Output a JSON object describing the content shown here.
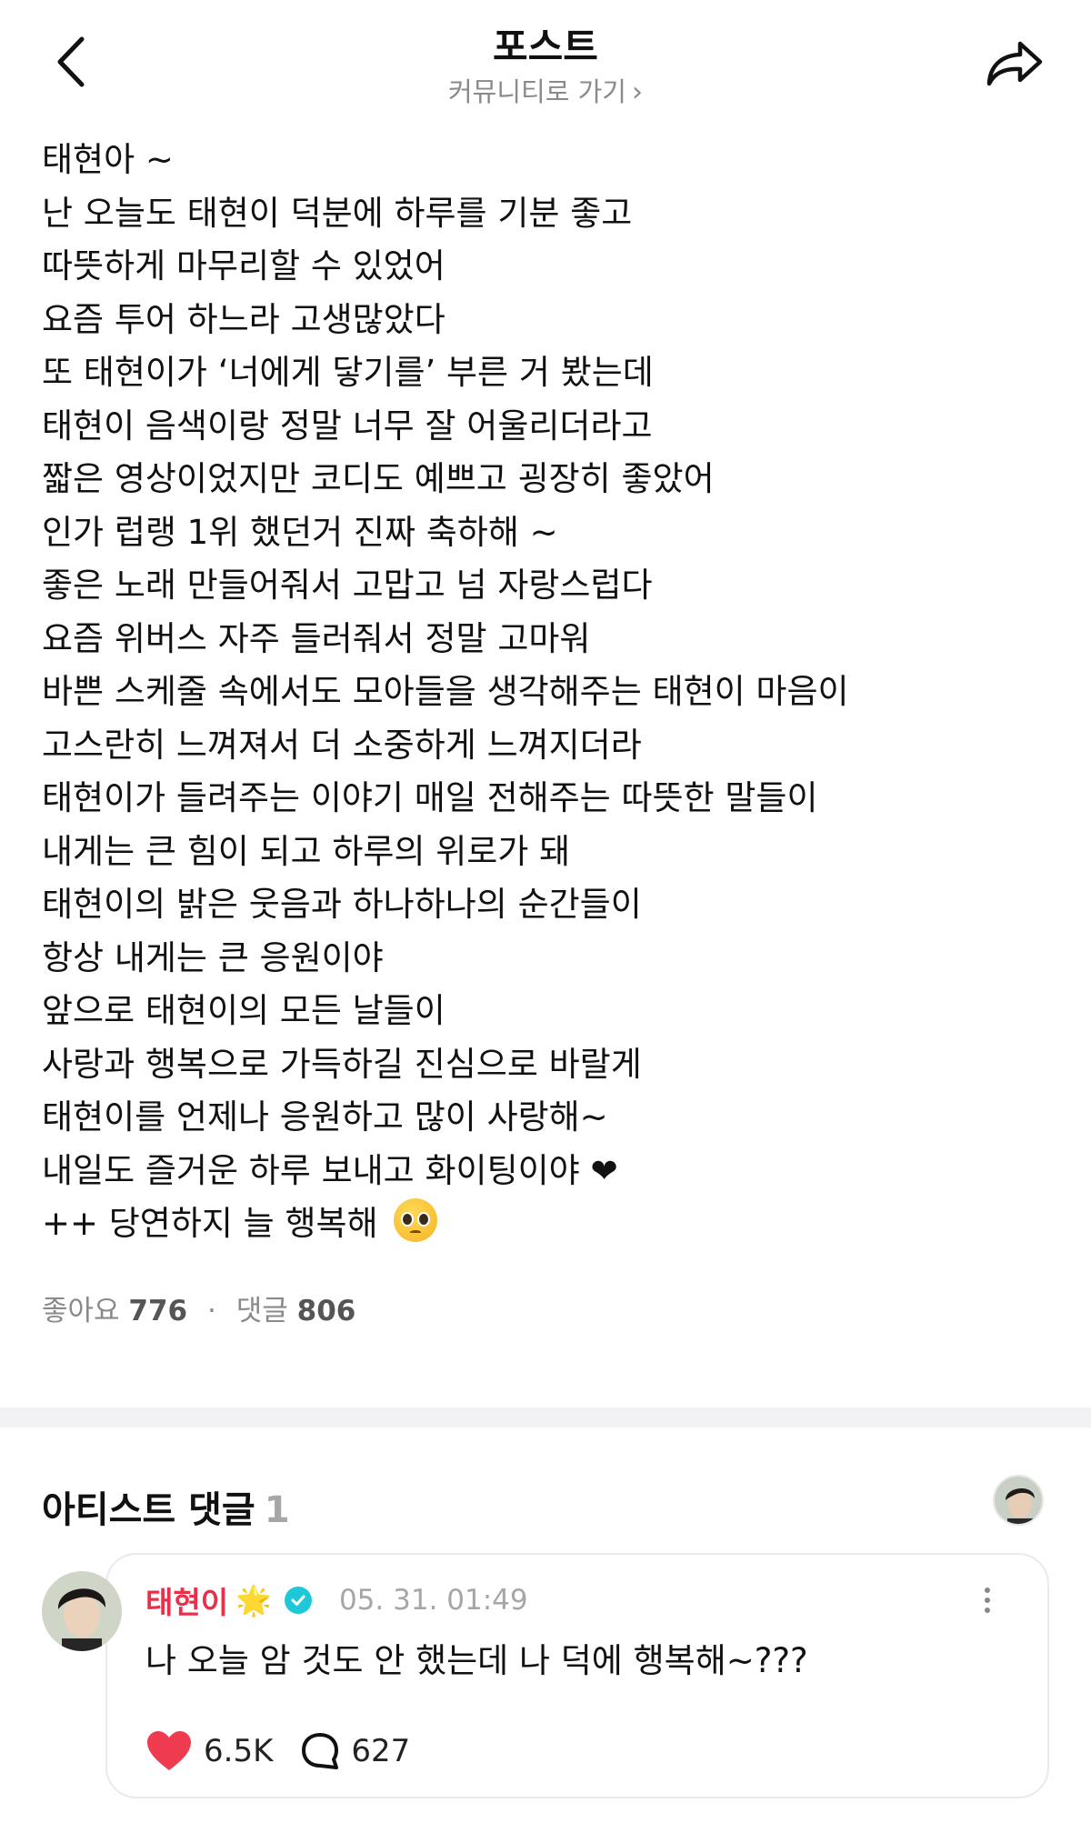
{
  "header": {
    "title": "포스트",
    "community_link": "커뮤니티로 가기",
    "community_chevron": "›"
  },
  "post": {
    "lines": [
      "태현아 ~",
      "난 오늘도 태현이 덕분에 하루를 기분 좋고",
      "따뜻하게 마무리할 수 있었어",
      "요즘 투어 하느라 고생많았다",
      "또 태현이가 ‘너에게 닿기를’ 부른 거 봤는데",
      "태현이 음색이랑 정말 너무 잘 어울리더라고",
      "짧은 영상이었지만 코디도 예쁘고 굉장히 좋았어",
      "인가 럽랭 1위 했던거 진짜 축하해 ~",
      "좋은 노래 만들어줘서 고맙고 넘 자랑스럽다",
      "요즘 위버스 자주 들러줘서 정말 고마워",
      "바쁜 스케줄 속에서도 모아들을 생각해주는 태현이 마음이",
      "고스란히 느껴져서 더 소중하게 느껴지더라",
      "태현이가 들려주는 이야기 매일 전해주는 따뜻한 말들이",
      "내게는 큰 힘이 되고 하루의 위로가 돼",
      "태현이의 밝은 웃음과 하나하나의 순간들이",
      "항상 내게는 큰 응원이야",
      "앞으로 태현이의 모든 날들이",
      "사랑과 행복으로 가득하길 진심으로 바랄게",
      "태현이를 언제나 응원하고 많이 사랑해~",
      "내일도 즐거운 하루 보내고 화이팅이야",
      "++ 당연하지 늘 행복해"
    ],
    "heart_glyph": "❤"
  },
  "stats": {
    "likes_label": "좋아요",
    "likes_count": "776",
    "separator": "·",
    "comments_label": "댓글",
    "comments_count": "806"
  },
  "artist_comments": {
    "heading": "아티스트 댓글",
    "count": "1"
  },
  "comment": {
    "author": "태현이",
    "author_emoji": "🌟",
    "timestamp": "05. 31. 01:49",
    "text": "나 오늘 암 것도 안 했는데 나 덕에 행복해~???",
    "like_count": "6.5K",
    "reply_count": "627"
  },
  "colors": {
    "accent_red": "#e8304b",
    "verified_teal": "#1ec8d8",
    "muted_gray": "#8a8a8a"
  },
  "icons": [
    "chevron-left-icon",
    "share-arrow-icon",
    "verified-icon",
    "more-vertical-icon",
    "heart-icon",
    "comment-bubble-icon",
    "pleading-face-emoji"
  ]
}
